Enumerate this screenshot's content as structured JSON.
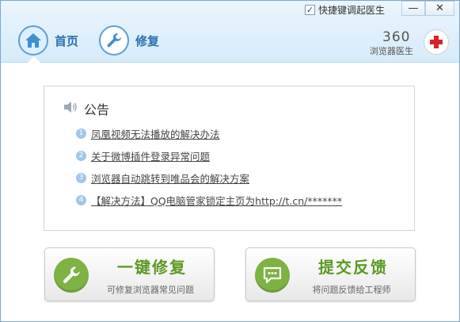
{
  "title_bar": {
    "quick_toggle_label": "快捷键调起医生",
    "quick_toggle_checked": true,
    "minimize_glyph": "—",
    "close_glyph": "✕"
  },
  "tabs": [
    {
      "label": "首页",
      "icon": "home-icon",
      "active": true
    },
    {
      "label": "修复",
      "icon": "wrench-icon",
      "active": false
    }
  ],
  "brand": {
    "logo_text": "360",
    "name": "浏览器医生",
    "badge_icon": "red-cross-icon"
  },
  "notice": {
    "title": "公告",
    "icon": "speaker-icon",
    "items": [
      {
        "number": "1",
        "text": "凤凰视频无法播放的解决办法"
      },
      {
        "number": "2",
        "text": "关于微博插件登录异常问题"
      },
      {
        "number": "3",
        "text": "浏览器自动跳转到唯品会的解决方案"
      },
      {
        "number": "4",
        "text": "【解决方法】QQ电脑管家锁定主页为http://t.cn/*******"
      }
    ]
  },
  "actions": {
    "repair": {
      "title": "一键修复",
      "subtitle": "可修复浏览器常见问题",
      "icon": "wrench-icon"
    },
    "feedback": {
      "title": "提交反馈",
      "subtitle": "将问题反馈给工程师",
      "icon": "chat-icon"
    }
  },
  "colors": {
    "accent_blue": "#2a70b2",
    "action_green": "#7cb342",
    "header_bg": "#d6ebfa"
  }
}
